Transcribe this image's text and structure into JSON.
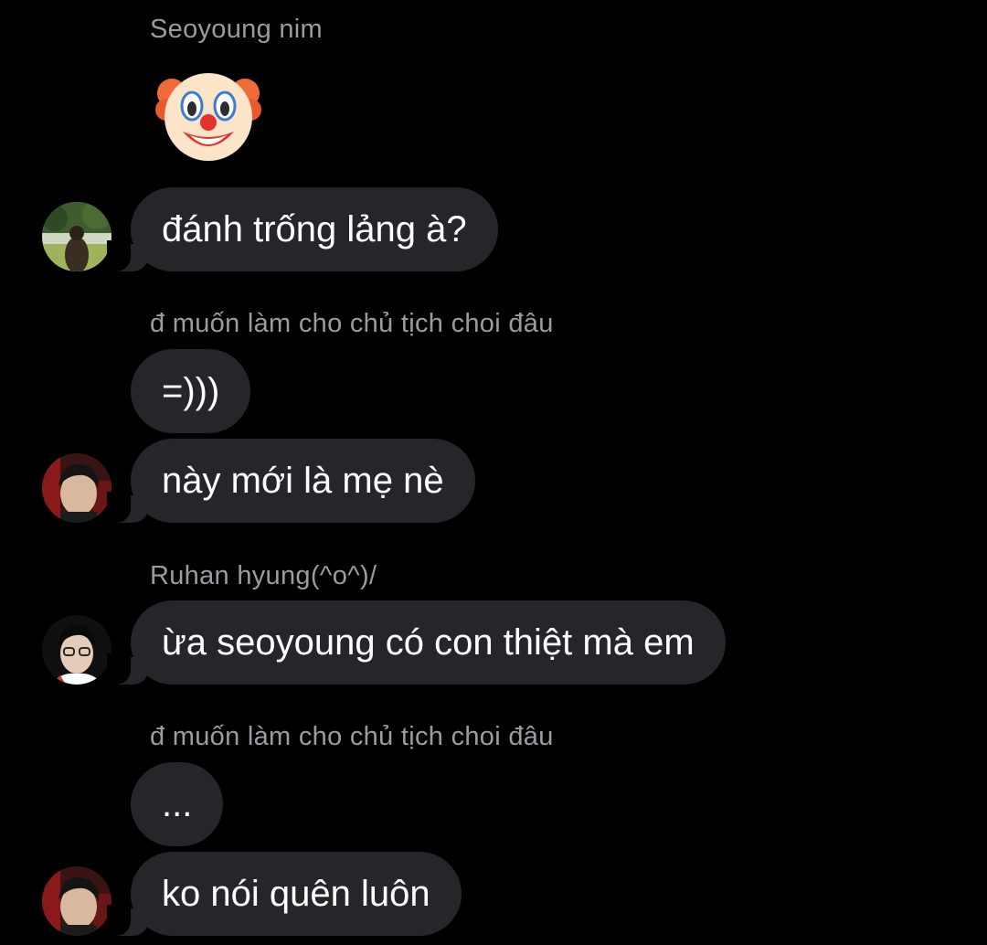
{
  "messages": [
    {
      "type": "sender",
      "name": "Seoyoung nim"
    },
    {
      "type": "emoji",
      "icon": "clown-face-emoji"
    },
    {
      "type": "bubble",
      "text": "đánh trống lảng à?",
      "avatar": "avatar-girl-in-field"
    },
    {
      "type": "sender",
      "name": "đ muốn làm cho chủ tịch choi đâu"
    },
    {
      "type": "bubble",
      "text": "=)))"
    },
    {
      "type": "bubble",
      "text": "này mới là mẹ nè",
      "avatar": "avatar-boy-selfie"
    },
    {
      "type": "sender",
      "name": "Ruhan hyung(^o^)/"
    },
    {
      "type": "bubble",
      "text": "ừa seoyoung có con thiệt mà em",
      "avatar": "avatar-boy-glasses"
    },
    {
      "type": "sender",
      "name": "đ muốn làm cho chủ tịch choi đâu"
    },
    {
      "type": "bubble",
      "text": "..."
    },
    {
      "type": "bubble",
      "text": "ko nói quên luôn",
      "avatar": "avatar-boy-selfie"
    }
  ],
  "colors": {
    "background": "#000000",
    "bubble": "#26252a",
    "sender_name": "#9b9ba1",
    "text": "#ffffff"
  }
}
